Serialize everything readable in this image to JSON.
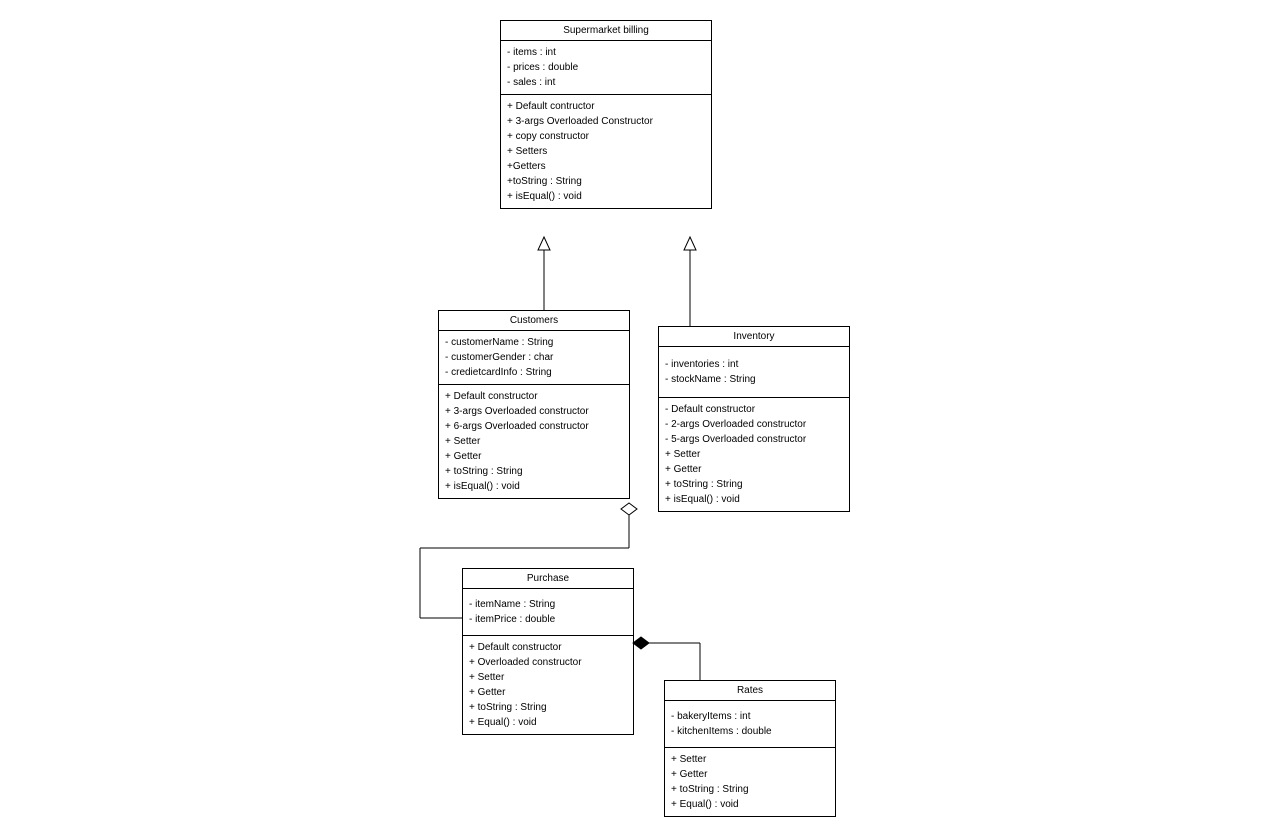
{
  "classes": {
    "supermarket": {
      "title": "Supermarket billing",
      "attrs": [
        "- items : int",
        "- prices : double",
        "- sales : int"
      ],
      "ops": [
        "+ Default contructor",
        "+ 3-args Overloaded Constructor",
        "+ copy constructor",
        "+ Setters",
        "+Getters",
        "+toString : String",
        "+ isEqual() : void"
      ]
    },
    "customers": {
      "title": "Customers",
      "attrs": [
        "- customerName : String",
        "- customerGender : char",
        "- credietcardInfo : String"
      ],
      "ops": [
        "+ Default constructor",
        "+ 3-args Overloaded constructor",
        "+ 6-args Overloaded constructor",
        "+ Setter",
        "+ Getter",
        "+ toString : String",
        "+ isEqual() : void"
      ]
    },
    "inventory": {
      "title": "Inventory",
      "attrs": [
        "- inventories : int",
        "- stockName : String"
      ],
      "ops": [
        "- Default constructor",
        "- 2-args Overloaded constructor",
        "- 5-args Overloaded constructor",
        "+ Setter",
        "+ Getter",
        "+ toString : String",
        "+ isEqual() : void"
      ]
    },
    "purchase": {
      "title": "Purchase",
      "attrs": [
        "- itemName : String",
        "- itemPrice : double"
      ],
      "ops": [
        "+ Default constructor",
        "+ Overloaded constructor",
        "+ Setter",
        "+ Getter",
        "+ toString : String",
        "+ Equal() : void"
      ]
    },
    "rates": {
      "title": "Rates",
      "attrs": [
        "- bakeryItems : int",
        "- kitchenItems : double"
      ],
      "ops": [
        "+ Setter",
        "+ Getter",
        "+ toString : String",
        "+ Equal() : void"
      ]
    }
  },
  "relations": [
    {
      "from": "customers",
      "to": "supermarket",
      "type": "generalization"
    },
    {
      "from": "inventory",
      "to": "supermarket",
      "type": "generalization"
    },
    {
      "from": "purchase",
      "to": "customers",
      "type": "aggregation"
    },
    {
      "from": "rates",
      "to": "purchase",
      "type": "composition"
    }
  ],
  "chart_data": {
    "type": "uml-class-diagram",
    "classes": [
      "Supermarket billing",
      "Customers",
      "Inventory",
      "Purchase",
      "Rates"
    ],
    "edges": [
      {
        "from": "Customers",
        "to": "Supermarket billing",
        "type": "generalization"
      },
      {
        "from": "Inventory",
        "to": "Supermarket billing",
        "type": "generalization"
      },
      {
        "from": "Purchase",
        "to": "Customers",
        "type": "aggregation"
      },
      {
        "from": "Rates",
        "to": "Purchase",
        "type": "composition"
      }
    ]
  }
}
